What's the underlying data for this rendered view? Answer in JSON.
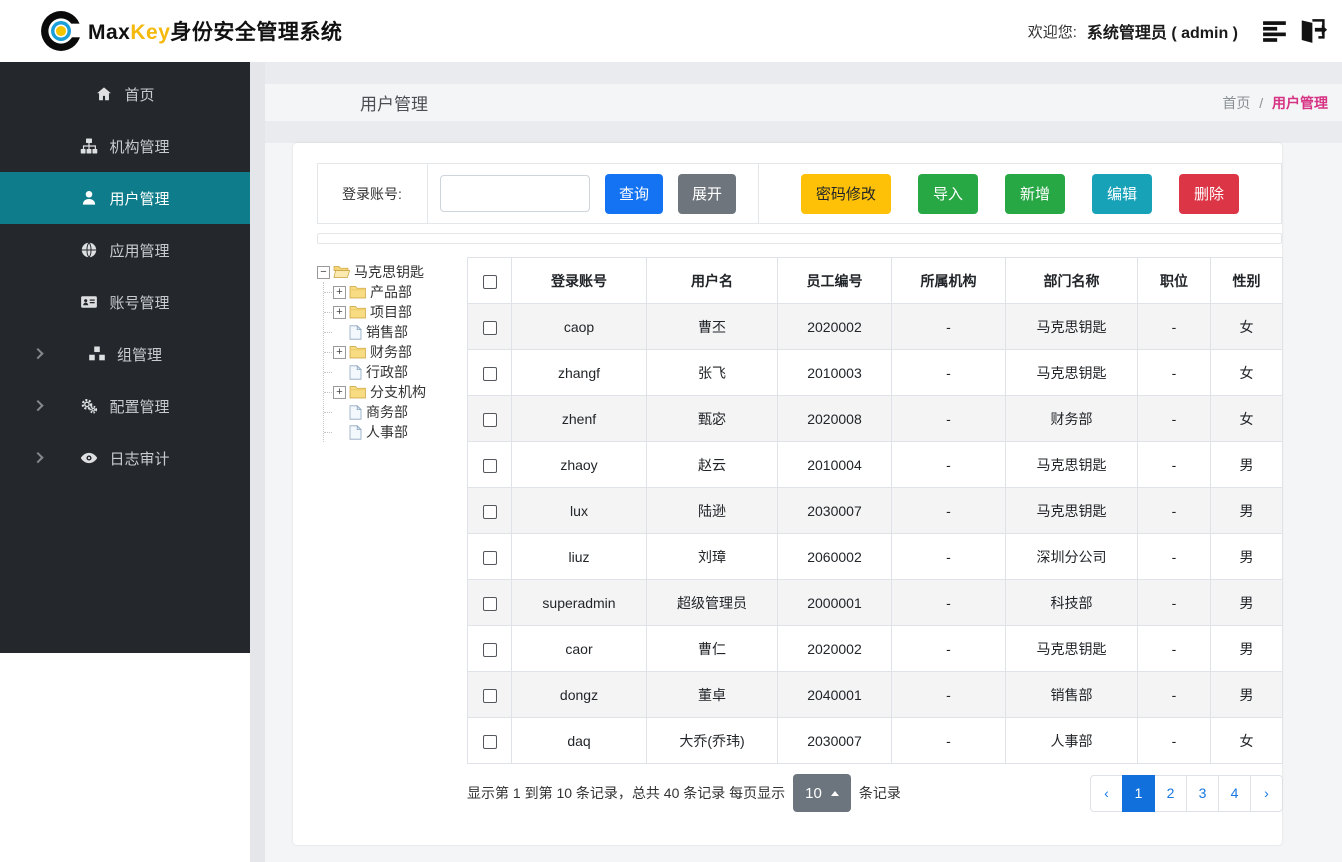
{
  "header": {
    "brand": {
      "max": "Max",
      "key": "Key",
      "suffix": "身份安全管理系统"
    },
    "welcome_label": "欢迎您:",
    "user_name": "系统管理员 ( admin )",
    "icons": [
      "list",
      "logout"
    ]
  },
  "sidebar": {
    "active_color": "#0e7c8a",
    "items": [
      {
        "label": "首页",
        "icon": "home",
        "active": false,
        "expandable": false
      },
      {
        "label": "机构管理",
        "icon": "sitemap",
        "active": false,
        "expandable": false
      },
      {
        "label": "用户管理",
        "icon": "user",
        "active": true,
        "expandable": false
      },
      {
        "label": "应用管理",
        "icon": "globe",
        "active": false,
        "expandable": false
      },
      {
        "label": "账号管理",
        "icon": "id-card",
        "active": false,
        "expandable": false
      },
      {
        "label": "组管理",
        "icon": "cubes",
        "active": false,
        "expandable": true
      },
      {
        "label": "配置管理",
        "icon": "gears",
        "active": false,
        "expandable": true
      },
      {
        "label": "日志审计",
        "icon": "eye",
        "active": false,
        "expandable": true
      }
    ]
  },
  "page": {
    "title": "用户管理",
    "breadcrumb_home": "首页",
    "breadcrumb_separator": "/",
    "breadcrumb_current": "用户管理",
    "breadcrumb_current_color": "#d63384"
  },
  "toolbar": {
    "search_label": "登录账号:",
    "search_value": "",
    "query_label": "查询",
    "query_bg": "#1473f2",
    "expand_label": "展开",
    "expand_bg": "#6e757c",
    "actions": [
      {
        "label": "密码修改",
        "bg": "#ffc107",
        "fg": "#212529"
      },
      {
        "label": "导入",
        "bg": "#28a745",
        "fg": "#ffffff"
      },
      {
        "label": "新增",
        "bg": "#28a745",
        "fg": "#ffffff"
      },
      {
        "label": "编辑",
        "bg": "#17a2b8",
        "fg": "#ffffff"
      },
      {
        "label": "删除",
        "bg": "#dc3545",
        "fg": "#ffffff"
      }
    ]
  },
  "tree": {
    "root": {
      "label": "马克思钥匙",
      "type": "folder-open",
      "expander": "−"
    },
    "children": [
      {
        "label": "产品部",
        "type": "folder",
        "expander": "+"
      },
      {
        "label": "项目部",
        "type": "folder",
        "expander": "+"
      },
      {
        "label": "销售部",
        "type": "file"
      },
      {
        "label": "财务部",
        "type": "folder",
        "expander": "+"
      },
      {
        "label": "行政部",
        "type": "file"
      },
      {
        "label": "分支机构",
        "type": "folder",
        "expander": "+"
      },
      {
        "label": "商务部",
        "type": "file"
      },
      {
        "label": "人事部",
        "type": "file"
      }
    ]
  },
  "table": {
    "columns": [
      "登录账号",
      "用户名",
      "员工编号",
      "所属机构",
      "部门名称",
      "职位",
      "性别"
    ],
    "rows": [
      [
        "caop",
        "曹丕",
        "2020002",
        "-",
        "马克思钥匙",
        "-",
        "女"
      ],
      [
        "zhangf",
        "张飞",
        "2010003",
        "-",
        "马克思钥匙",
        "-",
        "女"
      ],
      [
        "zhenf",
        "甄宓",
        "2020008",
        "-",
        "财务部",
        "-",
        "女"
      ],
      [
        "zhaoy",
        "赵云",
        "2010004",
        "-",
        "马克思钥匙",
        "-",
        "男"
      ],
      [
        "lux",
        "陆逊",
        "2030007",
        "-",
        "马克思钥匙",
        "-",
        "男"
      ],
      [
        "liuz",
        "刘璋",
        "2060002",
        "-",
        "深圳分公司",
        "-",
        "男"
      ],
      [
        "superadmin",
        "超级管理员",
        "2000001",
        "-",
        "科技部",
        "-",
        "男"
      ],
      [
        "caor",
        "曹仁",
        "2020002",
        "-",
        "马克思钥匙",
        "-",
        "男"
      ],
      [
        "dongz",
        "董卓",
        "2040001",
        "-",
        "销售部",
        "-",
        "男"
      ],
      [
        "daq",
        "大乔(乔玮)",
        "2030007",
        "-",
        "人事部",
        "-",
        "女"
      ]
    ]
  },
  "pagination": {
    "summary_prefix": "显示第 1 到第 10 条记录，总共 40 条记录  每页显示",
    "page_size": "10",
    "summary_suffix": "条记录",
    "prev": "‹",
    "next": "›",
    "pages": [
      "1",
      "2",
      "3",
      "4"
    ],
    "active_page": "1",
    "active_color": "#1270dd"
  }
}
